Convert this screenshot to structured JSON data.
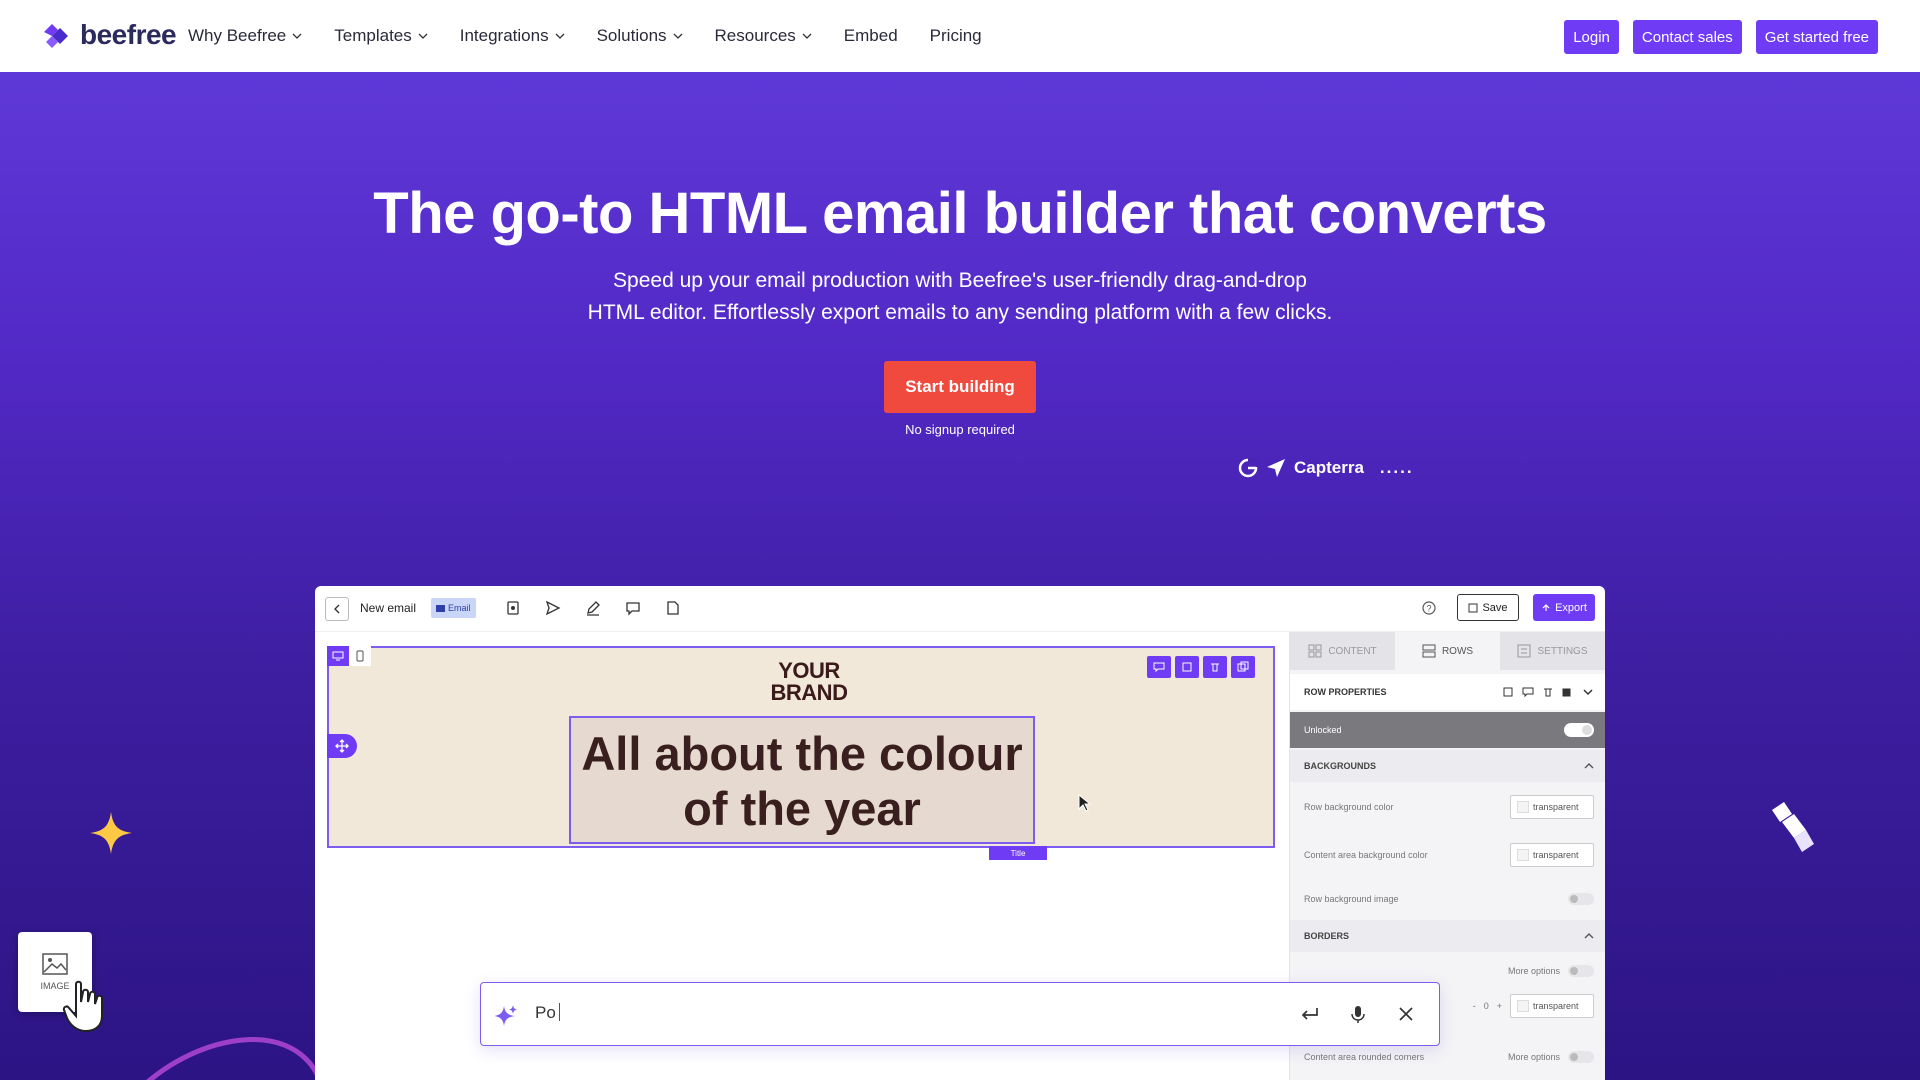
{
  "brand": {
    "name": "beefree",
    "accent": "#6f3bf5",
    "cta_color": "#f04a3e"
  },
  "nav": {
    "items": [
      {
        "label": "Why Beefree",
        "dropdown": true
      },
      {
        "label": "Templates",
        "dropdown": true
      },
      {
        "label": "Integrations",
        "dropdown": true
      },
      {
        "label": "Solutions",
        "dropdown": true
      },
      {
        "label": "Resources",
        "dropdown": true
      },
      {
        "label": "Embed",
        "dropdown": false
      },
      {
        "label": "Pricing",
        "dropdown": false
      }
    ],
    "login": "Login",
    "contact": "Contact sales",
    "get_started": "Get started free"
  },
  "hero": {
    "title": "The go-to HTML email builder that converts",
    "subtitle_line1": "Speed up your email production with Beefree's user-friendly drag-and-drop",
    "subtitle_line2": "HTML editor. Effortlessly export emails to any sending platform with a few clicks.",
    "cta": "Start building",
    "cta_note": "No signup required",
    "ratings_label": "Capterra",
    "ratings_dots": "....."
  },
  "editor": {
    "doc_title": "New email",
    "doc_tag": "Email",
    "save": "Save",
    "export": "Export",
    "brand_line1": "YOUR",
    "brand_line2": "BRAND",
    "headline_line1": "All about the colour",
    "headline_line2": "of the year",
    "title_tag": "Title",
    "tabs": [
      "CONTENT",
      "ROWS",
      "SETTINGS"
    ],
    "active_tab": "ROWS",
    "panel": {
      "row_properties": "ROW PROPERTIES",
      "unlocked": "Unlocked",
      "backgrounds": "BACKGROUNDS",
      "row_bg_color": "Row background color",
      "row_bg_value": "transparent",
      "content_bg_color": "Content area background color",
      "content_bg_value": "transparent",
      "row_bg_image": "Row background image",
      "borders": "BORDERS",
      "more_options_1": "More options",
      "border_width": "0",
      "border_value": "transparent",
      "rounded_corners": "Content area rounded corners",
      "more_options_2": "More options"
    }
  },
  "side_card": {
    "label": "IMAGE"
  },
  "ai_bar": {
    "value": "Po"
  }
}
